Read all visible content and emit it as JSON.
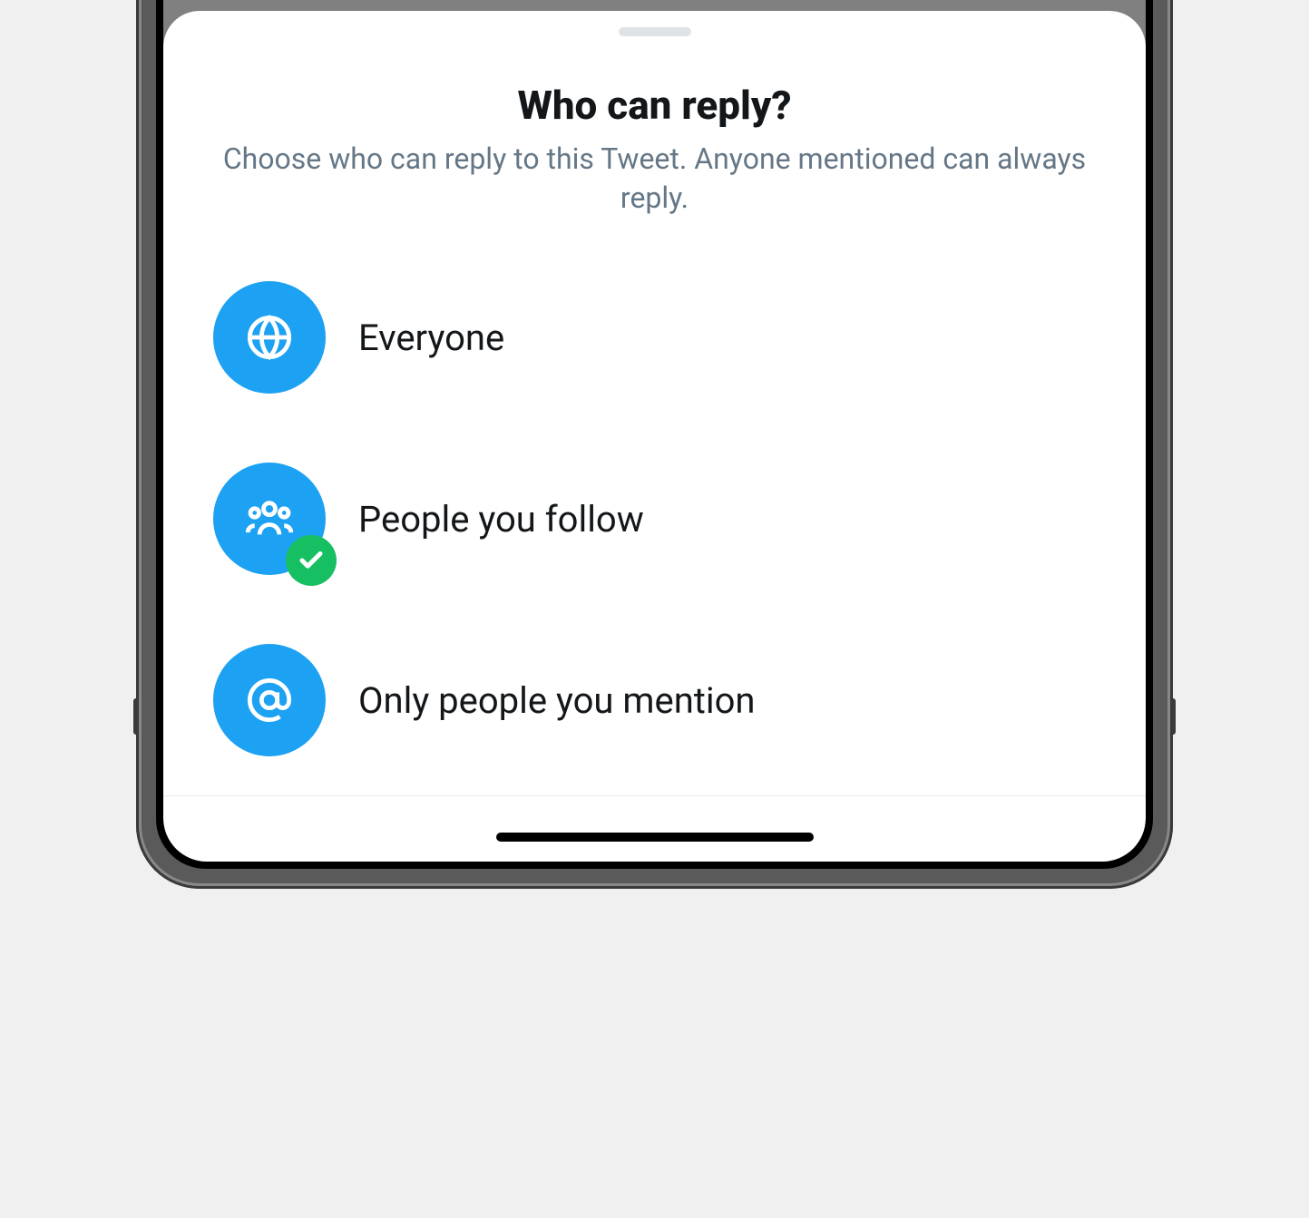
{
  "sheet": {
    "title": "Who can reply?",
    "subtitle": "Choose who can reply to this Tweet. Anyone mentioned can always reply."
  },
  "options": [
    {
      "id": "everyone",
      "label": "Everyone",
      "icon": "globe-icon",
      "selected": false
    },
    {
      "id": "follow",
      "label": "People you follow",
      "icon": "people-icon",
      "selected": true
    },
    {
      "id": "mention",
      "label": "Only people you mention",
      "icon": "at-icon",
      "selected": false
    }
  ],
  "colors": {
    "accent": "#1da1f2",
    "success": "#17bf63",
    "text_primary": "#14171a",
    "text_secondary": "#657786"
  }
}
